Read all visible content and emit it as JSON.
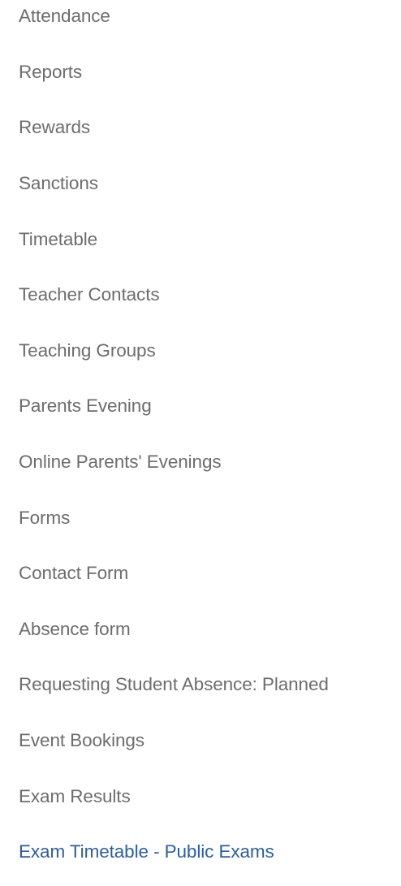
{
  "nav": {
    "items": [
      {
        "label": "Attendance"
      },
      {
        "label": "Reports"
      },
      {
        "label": "Rewards"
      },
      {
        "label": "Sanctions"
      },
      {
        "label": "Timetable"
      },
      {
        "label": "Teacher Contacts"
      },
      {
        "label": "Teaching Groups"
      },
      {
        "label": "Parents Evening"
      },
      {
        "label": "Online Parents' Evenings"
      },
      {
        "label": "Forms"
      },
      {
        "label": "Contact Form"
      },
      {
        "label": "Absence form"
      },
      {
        "label": "Requesting Student Absence: Planned"
      },
      {
        "label": "Event Bookings"
      },
      {
        "label": "Exam Results"
      },
      {
        "label": "Exam Timetable - Public Exams"
      }
    ],
    "active_index": 15
  },
  "colors": {
    "text": "#6d6d6d",
    "active_text": "#2c5ea3",
    "background": "#ffffff"
  }
}
